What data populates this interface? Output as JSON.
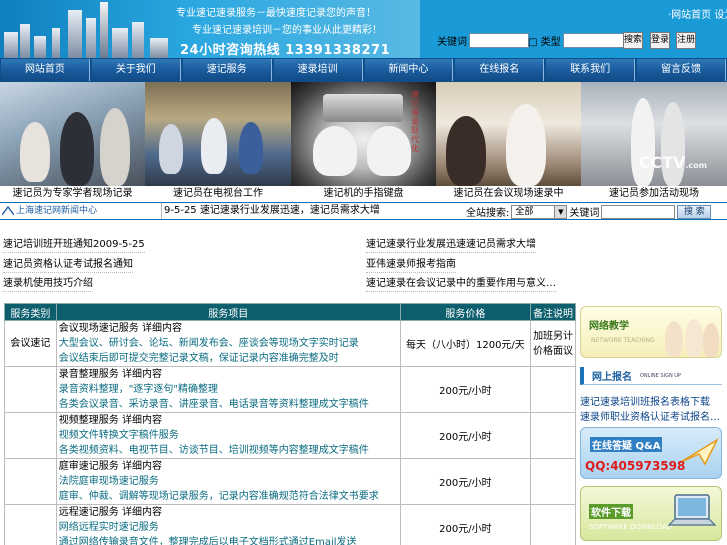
{
  "header": {
    "slogan1": "专业速记速录服务－最快速度记录您的声音！",
    "slogan2": "专业速记速录培训－您的事业从此更精彩！",
    "hotline": "24小时咨询热线  13391338271",
    "top_right_link": "·网站首页 设为首页",
    "search1_label": "关键词",
    "search2_label": "□ 类型",
    "btn1": "搜索",
    "btn2": "登录",
    "btn3": "注册"
  },
  "nav": {
    "items": [
      "网站首页",
      "关于我们",
      "速记服务",
      "速录培训",
      "新闻中心",
      "在线报名",
      "联系我们",
      "留言反馈"
    ]
  },
  "photos": {
    "cctv_logo": "CCTV",
    "cctv_suffix": ".com",
    "photo3_text": "速记速录现代化"
  },
  "captions": [
    "速记员为专家学者现场记录",
    "速记员在电视台工作",
    "速记机的手指键盘",
    "速记员在会议现场速录中",
    "速记员参加活动现场"
  ],
  "ticker": {
    "logo": "上海速记网新闻中心",
    "text": "9-5-25  速记速录行业发展迅速，速记员需求大增",
    "search_label": "全站搜索:",
    "select_value": "全部",
    "keyword_label": "关键词",
    "search_btn": "搜  索"
  },
  "news": [
    {
      "text": "速记培训班开班通知",
      "date": "2009-5-25"
    },
    {
      "text": "速记速录行业发展迅速速记员需求大增",
      "date": ""
    },
    {
      "text": "速记员资格认证考试报名通知",
      "date": ""
    },
    {
      "text": "亚伟速录师报考指南",
      "date": ""
    },
    {
      "text": "速录机使用技巧介绍",
      "date": ""
    },
    {
      "text": "速记速录在会议记录中的重要作用与意义…",
      "date": ""
    }
  ],
  "table": {
    "headers": [
      "服务类别",
      "服务项目",
      "服务价格",
      "备注说明"
    ],
    "rows": [
      {
        "category": "会议速记",
        "title": "会议现场速记服务 详细内容",
        "line1": "大型会议、研讨会、论坛、新闻发布会、座谈会等现场文字实时记录",
        "line2": "会议结束后即可提交完整记录文稿，保证记录内容准确完整及时",
        "price": "每天（八小时）1200元/天",
        "note1": "加班另计",
        "note2": "价格面议"
      },
      {
        "category": "",
        "title": "录音整理服务 详细内容",
        "line1": "录音资料整理，\"逐字逐句\"精确整理",
        "line2": "各类会议录音、采访录音、讲座录音、电话录音等资料整理成文字稿件",
        "price": "200元/小时",
        "note1": "",
        "note2": ""
      },
      {
        "category": "",
        "title": "视频整理服务 详细内容",
        "line1": "视频文件转换文字稿件服务",
        "line2": "各类视频资料、电视节目、访谈节目、培训视频等内容整理成文字稿件",
        "price": "200元/小时",
        "note1": "",
        "note2": ""
      },
      {
        "category": "",
        "title": "庭审速记服务 详细内容",
        "line1": "法院庭审现场速记服务",
        "line2": "庭审、仲裁、调解等现场记录服务，记录内容准确规范符合法律文书要求",
        "price": "200元/小时",
        "note1": "",
        "note2": ""
      },
      {
        "category": "",
        "title": "远程速记服务 详细内容",
        "line1": "网络远程实时速记服务",
        "line2": "通过网络传输录音文件，整理完成后以电子文档形式通过Email发送",
        "price": "200元/小时",
        "note1": "",
        "note2": ""
      }
    ]
  },
  "sidebar": {
    "teach_title": "网络教学",
    "teach_sub": "NETWORK TEACHING",
    "signup_title": "网上报名",
    "signup_sub": "ONLINE SIGN UP",
    "link1": "速记速录培训班报名表格下载",
    "link2": "速录师职业资格认证考试报名…",
    "qa_title": "在线答疑",
    "qa_sub": "Q&A",
    "qq": "QQ:405973598",
    "download_title": "软件下载",
    "download_sub": "SOFTWARE DOWNLOAD"
  }
}
